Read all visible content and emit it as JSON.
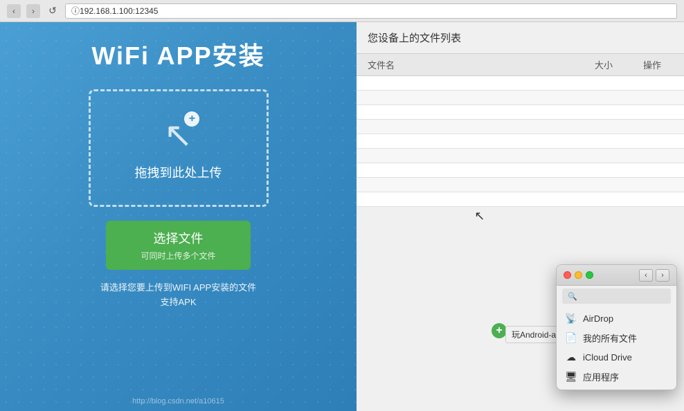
{
  "browser": {
    "back_label": "‹",
    "forward_label": "›",
    "refresh_label": "↺",
    "address": "192.168.1.100:12345"
  },
  "left_panel": {
    "title": "WiFi  APP安装",
    "drop_text": "拖拽到此处上传",
    "select_btn_label": "选择文件",
    "select_btn_sub": "可同时上传多个文件",
    "hint_line1": "请选择您要上传到WIFI APP安装的文件",
    "hint_line2": "支持APK"
  },
  "right_panel": {
    "section_title": "您设备上的文件列表",
    "col_name": "文件名",
    "col_size": "大小",
    "col_action": "操作",
    "rows": []
  },
  "drag": {
    "cursor_symbol": "↖",
    "plus_label": "+",
    "file_label": "玩Android-app-debug.apk"
  },
  "finder_popup": {
    "nav_back": "‹",
    "nav_forward": "›",
    "search_placeholder": "搜索",
    "items": [
      {
        "icon": "📡",
        "label": "AirDrop"
      },
      {
        "icon": "📄",
        "label": "我的所有文件"
      },
      {
        "icon": "☁",
        "label": "iCloud Drive"
      },
      {
        "icon": "🖥",
        "label": "应用程序"
      }
    ]
  },
  "watermark": "http://blog.csdn.net/a10615"
}
